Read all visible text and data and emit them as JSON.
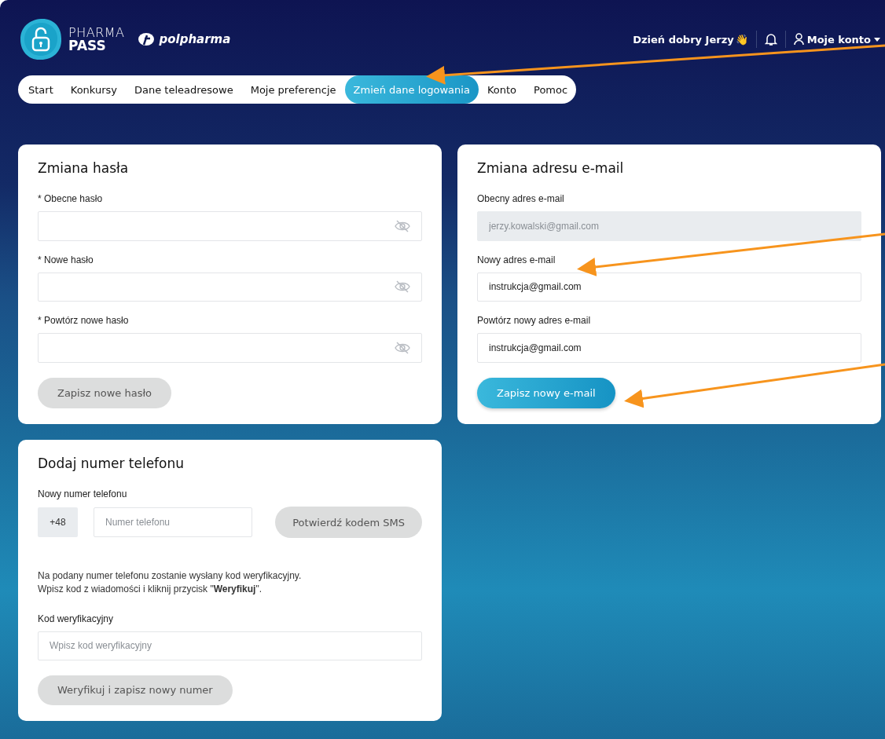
{
  "header": {
    "logo_top": "PHARMA",
    "logo_bottom": "PASS",
    "partner": "polpharma",
    "greeting": "Dzień dobry Jerzy",
    "greeting_emoji": "👋",
    "account": "Moje konto"
  },
  "tabs": [
    {
      "label": "Start",
      "selected": false
    },
    {
      "label": "Konkursy",
      "selected": false
    },
    {
      "label": "Dane teleadresowe",
      "selected": false
    },
    {
      "label": "Moje preferencje",
      "selected": false
    },
    {
      "label": "Zmień dane logowania",
      "selected": true
    },
    {
      "label": "Konto",
      "selected": false
    },
    {
      "label": "Pomoc",
      "selected": false
    }
  ],
  "password_card": {
    "title": "Zmiana hasła",
    "fields": [
      {
        "label": "* Obecne hasło"
      },
      {
        "label": "* Nowe hasło"
      },
      {
        "label": "* Powtórz nowe hasło"
      }
    ],
    "button": {
      "label": "Zapisz nowe hasło",
      "disabled": true
    }
  },
  "email_card": {
    "title": "Zmiana adresu e-mail",
    "fields": [
      {
        "label": "Obecny adres e-mail",
        "value": "jerzy.kowalski@gmail.com",
        "disabled": true
      },
      {
        "label": "Nowy adres e-mail",
        "value": "instrukcja@gmail.com",
        "disabled": false
      },
      {
        "label": "Powtórz nowy adres e-mail",
        "value": "instrukcja@gmail.com",
        "disabled": false
      }
    ],
    "button": {
      "label": "Zapisz nowy e-mail",
      "disabled": false
    }
  },
  "phone_card": {
    "title": "Dodaj numer telefonu",
    "label": "Nowy numer telefonu",
    "prefix": "+48",
    "placeholder": "Numer telefonu",
    "sms_button": {
      "label": "Potwierdź kodem SMS",
      "disabled": true
    },
    "info": [
      "Na podany numer telefonu zostanie wysłany kod weryfikacyjny.",
      "Wpisz kod z wiadomości i kliknij przycisk \"**Weryfikuj**\"."
    ],
    "code_label": "Kod weryfikacyjny",
    "code_placeholder": "Wpisz kod weryfikacyjny",
    "button": {
      "label": "Weryfikuj i zapisz nowy numer",
      "disabled": true
    }
  }
}
